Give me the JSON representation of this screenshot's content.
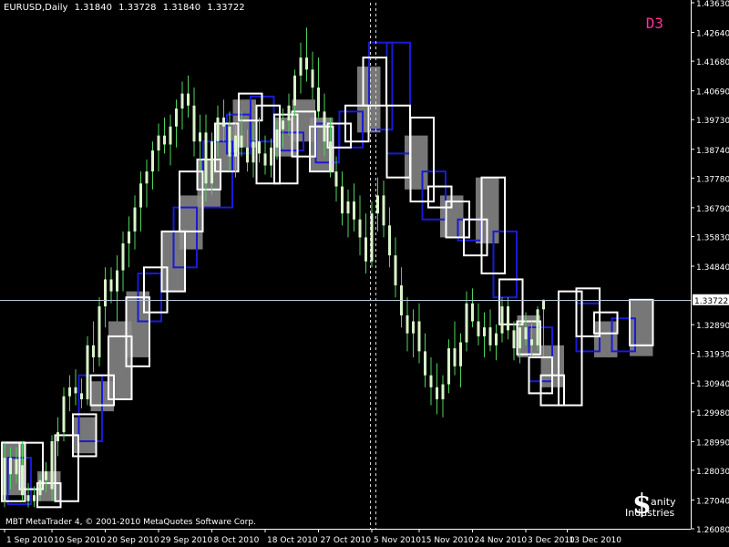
{
  "header": {
    "symbol": "EURUSD,Daily",
    "open": "1.31840",
    "high": "1.33728",
    "low": "1.31840",
    "close": "1.33722"
  },
  "timeframe_label": "D3",
  "copyright": "MBT MetaTrader 4, © 2001-2010 MetaQuotes Software Corp.",
  "logo": {
    "line1": "anity",
    "line2": "Industries"
  },
  "colors": {
    "background": "#000000",
    "axis": "#ffffff",
    "candle_body_daily": "#d9f5c8",
    "candle_wick_daily": "#4fd35a",
    "box_gray": "#8c8c8c",
    "box_white": "#ffffff",
    "box_blue": "#1a1ad6",
    "crosshair": "#b8c8d8",
    "timeframe_label": "#ff3399"
  },
  "chart_data": {
    "type": "candlestick",
    "ylim": [
      1.2608,
      1.4363
    ],
    "y_ticks": [
      "1.43630",
      "1.42640",
      "1.41680",
      "1.40690",
      "1.39730",
      "1.38740",
      "1.37780",
      "1.36790",
      "1.35830",
      "1.34840",
      "1.33722",
      "1.32890",
      "1.31930",
      "1.30940",
      "1.29980",
      "1.28990",
      "1.28030",
      "1.27040",
      "1.26080"
    ],
    "current_price": 1.33722,
    "current_price_label": "1.33722",
    "x_labels": [
      "1 Sep 2010",
      "10 Sep 2010",
      "20 Sep 2010",
      "29 Sep 2010",
      "8 Oct 2010",
      "18 Oct 2010",
      "27 Oct 2010",
      "5 Nov 2010",
      "15 Nov 2010",
      "24 Nov 2010",
      "3 Dec 2010",
      "13 Dec 2010"
    ],
    "x_label_bar_index": [
      0,
      8,
      17,
      26,
      35,
      44,
      53,
      62,
      70,
      79,
      88,
      95
    ],
    "vertical_markers_bar_index": [
      61.7,
      62.6
    ],
    "daily_bars": [
      {
        "o": 1.27,
        "h": 1.2895,
        "l": 1.268,
        "c": 1.2845
      },
      {
        "o": 1.2845,
        "h": 1.288,
        "l": 1.274,
        "c": 1.279
      },
      {
        "o": 1.279,
        "h": 1.288,
        "l": 1.276,
        "c": 1.284
      },
      {
        "o": 1.282,
        "h": 1.29,
        "l": 1.27,
        "c": 1.272
      },
      {
        "o": 1.272,
        "h": 1.276,
        "l": 1.268,
        "c": 1.27
      },
      {
        "o": 1.27,
        "h": 1.275,
        "l": 1.268,
        "c": 1.272
      },
      {
        "o": 1.272,
        "h": 1.279,
        "l": 1.27,
        "c": 1.277
      },
      {
        "o": 1.277,
        "h": 1.283,
        "l": 1.273,
        "c": 1.28
      },
      {
        "o": 1.274,
        "h": 1.292,
        "l": 1.27,
        "c": 1.29
      },
      {
        "o": 1.29,
        "h": 1.298,
        "l": 1.285,
        "c": 1.293
      },
      {
        "o": 1.293,
        "h": 1.308,
        "l": 1.29,
        "c": 1.305
      },
      {
        "o": 1.305,
        "h": 1.312,
        "l": 1.3,
        "c": 1.308
      },
      {
        "o": 1.308,
        "h": 1.314,
        "l": 1.302,
        "c": 1.306
      },
      {
        "o": 1.306,
        "h": 1.311,
        "l": 1.301,
        "c": 1.304
      },
      {
        "o": 1.304,
        "h": 1.325,
        "l": 1.302,
        "c": 1.322
      },
      {
        "o": 1.322,
        "h": 1.33,
        "l": 1.313,
        "c": 1.318
      },
      {
        "o": 1.318,
        "h": 1.338,
        "l": 1.315,
        "c": 1.335
      },
      {
        "o": 1.335,
        "h": 1.348,
        "l": 1.328,
        "c": 1.344
      },
      {
        "o": 1.344,
        "h": 1.348,
        "l": 1.336,
        "c": 1.34
      },
      {
        "o": 1.34,
        "h": 1.352,
        "l": 1.33,
        "c": 1.347
      },
      {
        "o": 1.347,
        "h": 1.36,
        "l": 1.34,
        "c": 1.356
      },
      {
        "o": 1.356,
        "h": 1.365,
        "l": 1.348,
        "c": 1.36
      },
      {
        "o": 1.36,
        "h": 1.372,
        "l": 1.354,
        "c": 1.368
      },
      {
        "o": 1.368,
        "h": 1.38,
        "l": 1.36,
        "c": 1.376
      },
      {
        "o": 1.376,
        "h": 1.384,
        "l": 1.368,
        "c": 1.38
      },
      {
        "o": 1.38,
        "h": 1.39,
        "l": 1.374,
        "c": 1.387
      },
      {
        "o": 1.387,
        "h": 1.396,
        "l": 1.38,
        "c": 1.392
      },
      {
        "o": 1.392,
        "h": 1.398,
        "l": 1.386,
        "c": 1.389
      },
      {
        "o": 1.389,
        "h": 1.399,
        "l": 1.382,
        "c": 1.395
      },
      {
        "o": 1.395,
        "h": 1.404,
        "l": 1.388,
        "c": 1.401
      },
      {
        "o": 1.401,
        "h": 1.41,
        "l": 1.394,
        "c": 1.406
      },
      {
        "o": 1.406,
        "h": 1.412,
        "l": 1.398,
        "c": 1.402
      },
      {
        "o": 1.402,
        "h": 1.408,
        "l": 1.385,
        "c": 1.39
      },
      {
        "o": 1.39,
        "h": 1.399,
        "l": 1.38,
        "c": 1.393
      },
      {
        "o": 1.393,
        "h": 1.399,
        "l": 1.37,
        "c": 1.376
      },
      {
        "o": 1.376,
        "h": 1.393,
        "l": 1.372,
        "c": 1.39
      },
      {
        "o": 1.39,
        "h": 1.402,
        "l": 1.385,
        "c": 1.398
      },
      {
        "o": 1.398,
        "h": 1.404,
        "l": 1.39,
        "c": 1.395
      },
      {
        "o": 1.395,
        "h": 1.4,
        "l": 1.38,
        "c": 1.385
      },
      {
        "o": 1.385,
        "h": 1.396,
        "l": 1.378,
        "c": 1.392
      },
      {
        "o": 1.392,
        "h": 1.4,
        "l": 1.385,
        "c": 1.388
      },
      {
        "o": 1.388,
        "h": 1.394,
        "l": 1.38,
        "c": 1.383
      },
      {
        "o": 1.383,
        "h": 1.396,
        "l": 1.378,
        "c": 1.39
      },
      {
        "o": 1.39,
        "h": 1.398,
        "l": 1.383,
        "c": 1.386
      },
      {
        "o": 1.386,
        "h": 1.392,
        "l": 1.379,
        "c": 1.382
      },
      {
        "o": 1.382,
        "h": 1.391,
        "l": 1.378,
        "c": 1.388
      },
      {
        "o": 1.388,
        "h": 1.397,
        "l": 1.384,
        "c": 1.394
      },
      {
        "o": 1.394,
        "h": 1.401,
        "l": 1.388,
        "c": 1.397
      },
      {
        "o": 1.397,
        "h": 1.406,
        "l": 1.392,
        "c": 1.402
      },
      {
        "o": 1.402,
        "h": 1.414,
        "l": 1.398,
        "c": 1.412
      },
      {
        "o": 1.412,
        "h": 1.423,
        "l": 1.406,
        "c": 1.418
      },
      {
        "o": 1.418,
        "h": 1.428,
        "l": 1.41,
        "c": 1.414
      },
      {
        "o": 1.414,
        "h": 1.42,
        "l": 1.404,
        "c": 1.408
      },
      {
        "o": 1.408,
        "h": 1.418,
        "l": 1.398,
        "c": 1.4
      },
      {
        "o": 1.4,
        "h": 1.406,
        "l": 1.385,
        "c": 1.39
      },
      {
        "o": 1.39,
        "h": 1.398,
        "l": 1.378,
        "c": 1.38
      },
      {
        "o": 1.38,
        "h": 1.385,
        "l": 1.37,
        "c": 1.375
      },
      {
        "o": 1.375,
        "h": 1.38,
        "l": 1.362,
        "c": 1.366
      },
      {
        "o": 1.366,
        "h": 1.374,
        "l": 1.358,
        "c": 1.37
      },
      {
        "o": 1.37,
        "h": 1.376,
        "l": 1.36,
        "c": 1.364
      },
      {
        "o": 1.364,
        "h": 1.372,
        "l": 1.352,
        "c": 1.358
      },
      {
        "o": 1.358,
        "h": 1.366,
        "l": 1.346,
        "c": 1.35
      },
      {
        "o": 1.35,
        "h": 1.37,
        "l": 1.348,
        "c": 1.366
      },
      {
        "o": 1.366,
        "h": 1.378,
        "l": 1.36,
        "c": 1.372
      },
      {
        "o": 1.372,
        "h": 1.377,
        "l": 1.358,
        "c": 1.362
      },
      {
        "o": 1.362,
        "h": 1.368,
        "l": 1.348,
        "c": 1.352
      },
      {
        "o": 1.352,
        "h": 1.358,
        "l": 1.338,
        "c": 1.342
      },
      {
        "o": 1.342,
        "h": 1.348,
        "l": 1.328,
        "c": 1.332
      },
      {
        "o": 1.332,
        "h": 1.338,
        "l": 1.32,
        "c": 1.326
      },
      {
        "o": 1.326,
        "h": 1.334,
        "l": 1.318,
        "c": 1.33
      },
      {
        "o": 1.33,
        "h": 1.336,
        "l": 1.316,
        "c": 1.32
      },
      {
        "o": 1.32,
        "h": 1.326,
        "l": 1.308,
        "c": 1.312
      },
      {
        "o": 1.312,
        "h": 1.318,
        "l": 1.302,
        "c": 1.308
      },
      {
        "o": 1.308,
        "h": 1.316,
        "l": 1.299,
        "c": 1.304
      },
      {
        "o": 1.304,
        "h": 1.312,
        "l": 1.298,
        "c": 1.309
      },
      {
        "o": 1.309,
        "h": 1.324,
        "l": 1.306,
        "c": 1.321
      },
      {
        "o": 1.321,
        "h": 1.33,
        "l": 1.312,
        "c": 1.315
      },
      {
        "o": 1.315,
        "h": 1.326,
        "l": 1.308,
        "c": 1.323
      },
      {
        "o": 1.323,
        "h": 1.34,
        "l": 1.32,
        "c": 1.336
      },
      {
        "o": 1.336,
        "h": 1.341,
        "l": 1.328,
        "c": 1.33
      },
      {
        "o": 1.33,
        "h": 1.336,
        "l": 1.322,
        "c": 1.325
      },
      {
        "o": 1.325,
        "h": 1.333,
        "l": 1.318,
        "c": 1.328
      },
      {
        "o": 1.328,
        "h": 1.334,
        "l": 1.32,
        "c": 1.322
      },
      {
        "o": 1.322,
        "h": 1.329,
        "l": 1.317,
        "c": 1.326
      },
      {
        "o": 1.326,
        "h": 1.338,
        "l": 1.323,
        "c": 1.335
      },
      {
        "o": 1.335,
        "h": 1.338,
        "l": 1.324,
        "c": 1.327
      },
      {
        "o": 1.327,
        "h": 1.33,
        "l": 1.317,
        "c": 1.321
      },
      {
        "o": 1.321,
        "h": 1.33,
        "l": 1.316,
        "c": 1.328
      },
      {
        "o": 1.328,
        "h": 1.333,
        "l": 1.322,
        "c": 1.324
      },
      {
        "o": 1.324,
        "h": 1.33,
        "l": 1.318,
        "c": 1.322
      },
      {
        "o": 1.322,
        "h": 1.335,
        "l": 1.32,
        "c": 1.334
      },
      {
        "o": 1.334,
        "h": 1.3373,
        "l": 1.3184,
        "c": 1.3372
      }
    ],
    "boxes": [
      {
        "type": "gray",
        "i0": 0,
        "i1": 3,
        "top": 1.29,
        "bottom": 1.272
      },
      {
        "type": "white",
        "i0": 0,
        "i1": 3,
        "top": 1.2895,
        "bottom": 1.27
      },
      {
        "type": "blue",
        "i0": 1,
        "i1": 4,
        "top": 1.2845,
        "bottom": 1.269
      },
      {
        "type": "white",
        "i0": 3,
        "i1": 6,
        "top": 1.2895,
        "bottom": 1.274
      },
      {
        "type": "gray",
        "i0": 6,
        "i1": 9,
        "top": 1.28,
        "bottom": 1.27
      },
      {
        "type": "white",
        "i0": 6,
        "i1": 9,
        "top": 1.276,
        "bottom": 1.268
      },
      {
        "type": "white",
        "i0": 9,
        "i1": 12,
        "top": 1.292,
        "bottom": 1.27
      },
      {
        "type": "gray",
        "i0": 12,
        "i1": 15,
        "top": 1.298,
        "bottom": 1.286
      },
      {
        "type": "white",
        "i0": 12,
        "i1": 15,
        "top": 1.299,
        "bottom": 1.285
      },
      {
        "type": "blue",
        "i0": 13,
        "i1": 16,
        "top": 1.312,
        "bottom": 1.29
      },
      {
        "type": "gray",
        "i0": 15,
        "i1": 18,
        "top": 1.31,
        "bottom": 1.3
      },
      {
        "type": "white",
        "i0": 15,
        "i1": 18,
        "top": 1.312,
        "bottom": 1.302
      },
      {
        "type": "gray",
        "i0": 18,
        "i1": 21,
        "top": 1.33,
        "bottom": 1.304
      },
      {
        "type": "white",
        "i0": 18,
        "i1": 21,
        "top": 1.325,
        "bottom": 1.304
      },
      {
        "type": "gray",
        "i0": 21,
        "i1": 24,
        "top": 1.34,
        "bottom": 1.318
      },
      {
        "type": "white",
        "i0": 21,
        "i1": 24,
        "top": 1.338,
        "bottom": 1.315
      },
      {
        "type": "blue",
        "i0": 23,
        "i1": 26,
        "top": 1.346,
        "bottom": 1.33
      },
      {
        "type": "white",
        "i0": 24,
        "i1": 27,
        "top": 1.348,
        "bottom": 1.333
      },
      {
        "type": "gray",
        "i0": 27,
        "i1": 30,
        "top": 1.36,
        "bottom": 1.34
      },
      {
        "type": "white",
        "i0": 27,
        "i1": 30,
        "top": 1.36,
        "bottom": 1.34
      },
      {
        "type": "blue",
        "i0": 29,
        "i1": 32,
        "top": 1.368,
        "bottom": 1.348
      },
      {
        "type": "gray",
        "i0": 30,
        "i1": 33,
        "top": 1.372,
        "bottom": 1.354
      },
      {
        "type": "white",
        "i0": 30,
        "i1": 33,
        "top": 1.38,
        "bottom": 1.36
      },
      {
        "type": "gray",
        "i0": 33,
        "i1": 36,
        "top": 1.384,
        "bottom": 1.368
      },
      {
        "type": "white",
        "i0": 33,
        "i1": 36,
        "top": 1.384,
        "bottom": 1.374
      },
      {
        "type": "blue",
        "i0": 34,
        "i1": 38,
        "top": 1.39,
        "bottom": 1.368
      },
      {
        "type": "gray",
        "i0": 36,
        "i1": 39,
        "top": 1.396,
        "bottom": 1.38
      },
      {
        "type": "white",
        "i0": 36,
        "i1": 39,
        "top": 1.396,
        "bottom": 1.38
      },
      {
        "type": "blue",
        "i0": 38,
        "i1": 41,
        "top": 1.399,
        "bottom": 1.386
      },
      {
        "type": "gray",
        "i0": 39,
        "i1": 42,
        "top": 1.404,
        "bottom": 1.388
      },
      {
        "type": "white",
        "i0": 40,
        "i1": 43,
        "top": 1.406,
        "bottom": 1.397
      },
      {
        "type": "blue",
        "i0": 42,
        "i1": 45,
        "top": 1.405,
        "bottom": 1.39
      },
      {
        "type": "white",
        "i0": 43,
        "i1": 46,
        "top": 1.402,
        "bottom": 1.376
      },
      {
        "type": "gray",
        "i0": 46,
        "i1": 49,
        "top": 1.398,
        "bottom": 1.385
      },
      {
        "type": "white",
        "i0": 46,
        "i1": 49,
        "top": 1.399,
        "bottom": 1.376
      },
      {
        "type": "blue",
        "i0": 47,
        "i1": 50,
        "top": 1.393,
        "bottom": 1.387
      },
      {
        "type": "gray",
        "i0": 49,
        "i1": 52,
        "top": 1.404,
        "bottom": 1.39
      },
      {
        "type": "white",
        "i0": 49,
        "i1": 52,
        "top": 1.4,
        "bottom": 1.385
      },
      {
        "type": "gray",
        "i0": 52,
        "i1": 55,
        "top": 1.398,
        "bottom": 1.38
      },
      {
        "type": "white",
        "i0": 52,
        "i1": 55,
        "top": 1.395,
        "bottom": 1.38
      },
      {
        "type": "blue",
        "i0": 53,
        "i1": 56,
        "top": 1.396,
        "bottom": 1.383
      },
      {
        "type": "white",
        "i0": 55,
        "i1": 58,
        "top": 1.396,
        "bottom": 1.388
      },
      {
        "type": "blue",
        "i0": 57,
        "i1": 60,
        "top": 1.4,
        "bottom": 1.388
      },
      {
        "type": "white",
        "i0": 58,
        "i1": 61,
        "top": 1.402,
        "bottom": 1.39
      },
      {
        "type": "gray",
        "i0": 60,
        "i1": 63,
        "top": 1.415,
        "bottom": 1.393
      },
      {
        "type": "white",
        "i0": 61,
        "i1": 64,
        "top": 1.418,
        "bottom": 1.402
      },
      {
        "type": "blue",
        "i0": 62,
        "i1": 65,
        "top": 1.423,
        "bottom": 1.394
      },
      {
        "type": "blue",
        "i0": 65,
        "i1": 68,
        "top": 1.423,
        "bottom": 1.386
      },
      {
        "type": "white",
        "i0": 65,
        "i1": 68,
        "top": 1.402,
        "bottom": 1.378
      },
      {
        "type": "gray",
        "i0": 68,
        "i1": 71,
        "top": 1.392,
        "bottom": 1.374
      },
      {
        "type": "white",
        "i0": 69,
        "i1": 72,
        "top": 1.398,
        "bottom": 1.37
      },
      {
        "type": "blue",
        "i0": 71,
        "i1": 74,
        "top": 1.38,
        "bottom": 1.364
      },
      {
        "type": "white",
        "i0": 72,
        "i1": 75,
        "top": 1.375,
        "bottom": 1.368
      },
      {
        "type": "gray",
        "i0": 74,
        "i1": 77,
        "top": 1.372,
        "bottom": 1.358
      },
      {
        "type": "white",
        "i0": 75,
        "i1": 78,
        "top": 1.37,
        "bottom": 1.358
      },
      {
        "type": "blue",
        "i0": 77,
        "i1": 80,
        "top": 1.364,
        "bottom": 1.357
      },
      {
        "type": "white",
        "i0": 78,
        "i1": 81,
        "top": 1.364,
        "bottom": 1.352
      },
      {
        "type": "gray",
        "i0": 80,
        "i1": 83,
        "top": 1.378,
        "bottom": 1.356
      },
      {
        "type": "white",
        "i0": 81,
        "i1": 84,
        "top": 1.378,
        "bottom": 1.346
      },
      {
        "type": "blue",
        "i0": 83,
        "i1": 86,
        "top": 1.36,
        "bottom": 1.338
      },
      {
        "type": "white",
        "i0": 84,
        "i1": 87,
        "top": 1.344,
        "bottom": 1.329
      },
      {
        "type": "gray",
        "i0": 87,
        "i1": 90,
        "top": 1.332,
        "bottom": 1.318
      },
      {
        "type": "white",
        "i0": 87,
        "i1": 90,
        "top": 1.33,
        "bottom": 1.319
      },
      {
        "type": "blue",
        "i0": 89,
        "i1": 92,
        "top": 1.328,
        "bottom": 1.31
      },
      {
        "type": "white",
        "i0": 89,
        "i1": 92,
        "top": 1.318,
        "bottom": 1.306
      },
      {
        "type": "gray",
        "i0": 91,
        "i1": 94,
        "top": 1.322,
        "bottom": 1.308
      },
      {
        "type": "white",
        "i0": 91,
        "i1": 94,
        "top": 1.312,
        "bottom": 1.302
      },
      {
        "type": "white",
        "i0": 94,
        "i1": 97,
        "top": 1.34,
        "bottom": 1.302
      },
      {
        "type": "white",
        "i0": 97,
        "i1": 100,
        "top": 1.341,
        "bottom": 1.325
      },
      {
        "type": "blue",
        "i0": 97,
        "i1": 100,
        "top": 1.336,
        "bottom": 1.32
      },
      {
        "type": "gray",
        "i0": 100,
        "i1": 103,
        "top": 1.33,
        "bottom": 1.318
      },
      {
        "type": "white",
        "i0": 100,
        "i1": 103,
        "top": 1.333,
        "bottom": 1.326
      },
      {
        "type": "blue",
        "i0": 103,
        "i1": 106,
        "top": 1.331,
        "bottom": 1.32
      },
      {
        "type": "gray",
        "i0": 106,
        "i1": 109,
        "top": 1.3372,
        "bottom": 1.3184
      },
      {
        "type": "white",
        "i0": 106,
        "i1": 109,
        "top": 1.3372,
        "bottom": 1.322
      }
    ]
  }
}
